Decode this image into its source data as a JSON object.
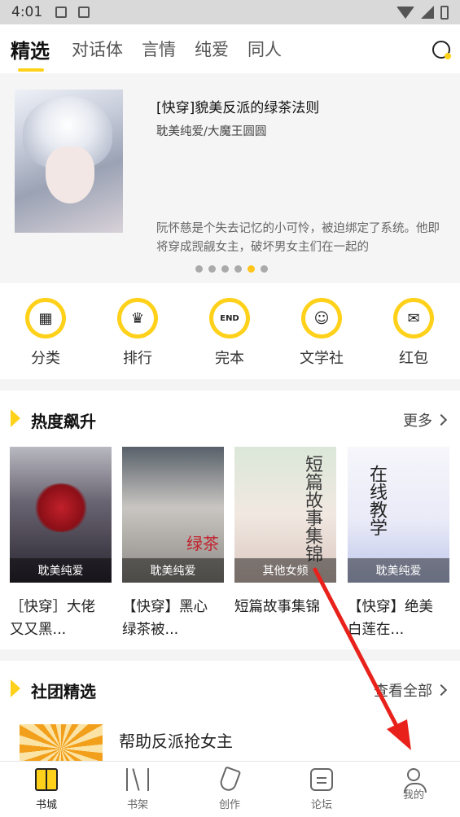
{
  "status_bar": {
    "time": "4:01"
  },
  "header": {
    "tabs": [
      {
        "label": "精选",
        "active": true
      },
      {
        "label": "对话体"
      },
      {
        "label": "言情"
      },
      {
        "label": "纯爱"
      },
      {
        "label": "同人"
      }
    ],
    "search_icon": "search-icon"
  },
  "banner": {
    "title": "[快穿]貌美反派的绿茶法则",
    "subtitle": "耽美纯爱/大魔王圆圆",
    "description": "阮怀慈是个失去记忆的小可怜，被迫绑定了系统。他即将穿成觊觎女主，破坏男女主们在一起的",
    "dots_count": 6,
    "active_dot": 4
  },
  "quick_links": [
    {
      "label": "分类",
      "icon": "category-icon",
      "glyph": "▦"
    },
    {
      "label": "排行",
      "icon": "trophy-icon",
      "glyph": "♛"
    },
    {
      "label": "完本",
      "icon": "end-icon",
      "glyph": "END"
    },
    {
      "label": "文学社",
      "icon": "club-icon",
      "glyph": "☺"
    },
    {
      "label": "红包",
      "icon": "red-packet-icon",
      "glyph": "✉"
    }
  ],
  "hot_section": {
    "title": "热度飙升",
    "more_label": "更多",
    "books": [
      {
        "title": "［快穿］大佬又又黑...",
        "tag": "耽美纯爱",
        "cover_text": ""
      },
      {
        "title": "【快穿】黑心绿茶被...",
        "tag": "耽美纯爱",
        "cover_text": "绿茶"
      },
      {
        "title": "短篇故事集锦",
        "tag": "其他女频",
        "cover_text": "短篇故事集锦"
      },
      {
        "title": "【快穿】绝美白莲在...",
        "tag": "耽美纯爱",
        "cover_text": "在线教学"
      }
    ]
  },
  "club_section": {
    "title": "社团精选",
    "more_label": "查看全部",
    "first_book_title": "帮助反派抢女主"
  },
  "bottom_nav": [
    {
      "label": "书城",
      "icon": "bookstore-icon",
      "active": true
    },
    {
      "label": "书架",
      "icon": "bookshelf-icon"
    },
    {
      "label": "创作",
      "icon": "pen-icon"
    },
    {
      "label": "论坛",
      "icon": "forum-icon"
    },
    {
      "label": "我的",
      "icon": "profile-icon"
    }
  ],
  "colors": {
    "accent": "#ffd11a",
    "annotation_arrow": "#e8221b"
  }
}
